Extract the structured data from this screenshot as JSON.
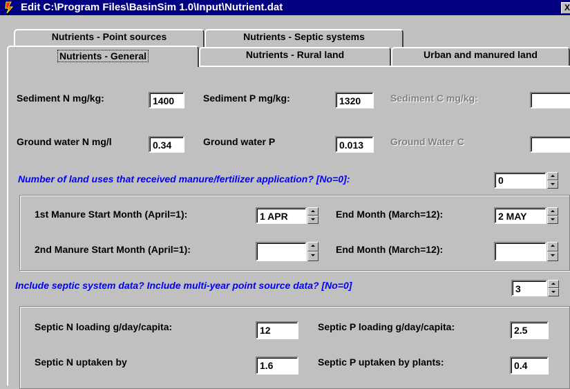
{
  "window": {
    "title": "Edit C:\\Program Files\\BasinSim 1.0\\Input\\Nutrient.dat",
    "close": "X"
  },
  "tabs": {
    "row1": [
      "Nutrients - Point sources",
      "Nutrients - Septic systems"
    ],
    "row2": [
      "Nutrients - General",
      "Nutrients - Rural land",
      "Urban and manured land"
    ],
    "active": "Nutrients - General"
  },
  "general": {
    "sediment_n_label": "Sediment N mg/kg:",
    "sediment_n_value": "1400",
    "sediment_p_label": "Sediment P mg/kg:",
    "sediment_p_value": "1320",
    "sediment_c_label": "Sediment C mg/kg:",
    "sediment_c_value": "",
    "gw_n_label": "Ground water N mg/l",
    "gw_n_value": "0.34",
    "gw_p_label": "Ground water P",
    "gw_p_value": "0.013",
    "gw_c_label": "Ground Water C",
    "gw_c_value": ""
  },
  "manure": {
    "question": "Number of land uses that received manure/fertilizer application? [No=0]:",
    "count_value": "0",
    "start1_label": "1st Manure Start Month (April=1):",
    "start1_value": "1 APR",
    "end1_label": "End Month (March=12):",
    "end1_value": "2 MAY",
    "start2_label": "2nd Manure Start Month (April=1):",
    "start2_value": "",
    "end2_label": "End Month (March=12):",
    "end2_value": ""
  },
  "septic": {
    "question": "Include septic system data? Include multi-year point source data? [No=0]",
    "count_value": "3",
    "n_loading_label": "Septic N loading g/day/capita:",
    "n_loading_value": "12",
    "p_loading_label": "Septic P loading g/day/capita:",
    "p_loading_value": "2.5",
    "n_uptake_label": "Septic N uptaken by",
    "n_uptake_value": "1.6",
    "p_uptake_label": "Septic P uptaken by plants:",
    "p_uptake_value": "0.4"
  }
}
